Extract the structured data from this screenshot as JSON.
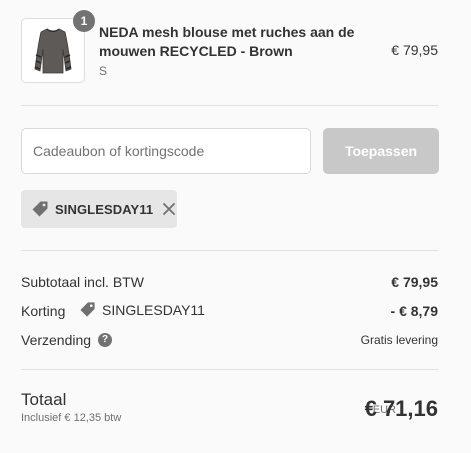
{
  "product": {
    "quantity": "1",
    "name": "NEDA mesh blouse met ruches aan de mouwen RECYCLED - Brown",
    "variant": "S",
    "price": "€ 79,95"
  },
  "discount_form": {
    "placeholder": "Cadeaubon of kortingscode",
    "apply_label": "Toepassen"
  },
  "applied_code": {
    "code": "SINGLESDAY11"
  },
  "summary": {
    "subtotal_label": "Subtotaal incl. BTW",
    "subtotal_value": "€ 79,95",
    "discount_label": "Korting",
    "discount_code": "SINGLESDAY11",
    "discount_value": "- € 8,79",
    "shipping_label": "Verzending",
    "shipping_value": "Gratis levering"
  },
  "total": {
    "label": "Totaal",
    "tax_note": "Inclusief € 12,35 btw",
    "currency": "EUR",
    "amount": "€ 71,16"
  },
  "icons": {
    "tag": "tag-icon",
    "remove": "close-icon",
    "help": "question-icon"
  }
}
